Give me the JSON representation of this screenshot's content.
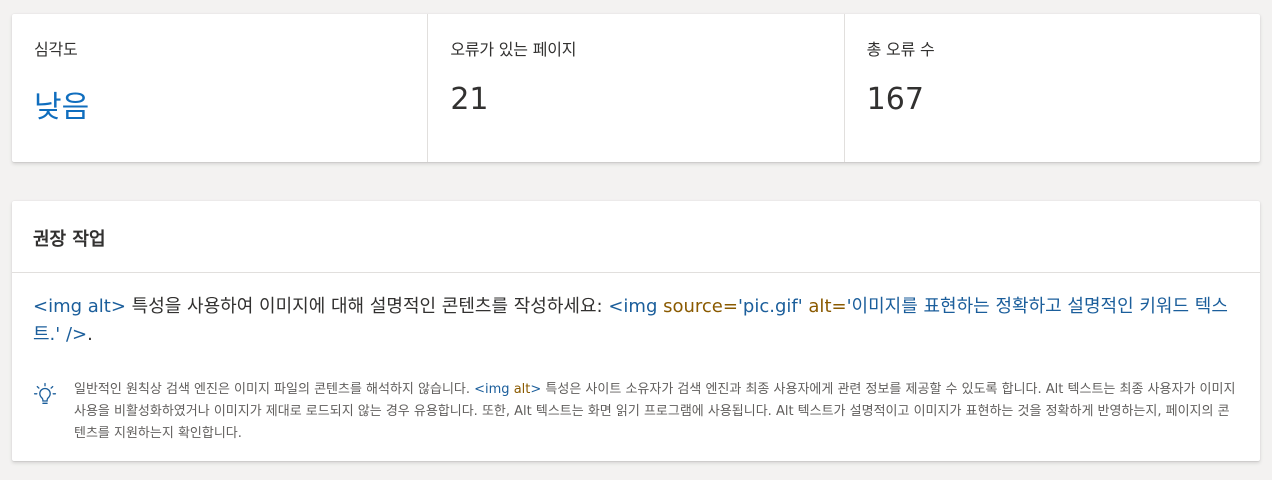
{
  "stats": {
    "severity_label": "심각도",
    "severity_value": "낮음",
    "pages_label": "오류가 있는 페이지",
    "pages_value": "21",
    "errors_label": "총 오류 수",
    "errors_value": "167"
  },
  "recommendation": {
    "title": "권장 작업",
    "main": {
      "code1": "<img alt>",
      "text1": " 특성을 사용하여 이미지에 대해 설명적인 콘텐츠를 작성하세요: ",
      "code2a": "<img ",
      "code2b": "source=",
      "code2c": "'pic.gif' ",
      "code2d": "alt=",
      "code2e": "'이미지를 표현하는 정확하고 설명적인 키워드 텍스트.' />",
      "text2": "."
    },
    "tip": {
      "icon": "lightbulb-icon",
      "text1": "일반적인 원칙상 검색 엔진은 이미지 파일의 콘텐츠를 해석하지 않습니다. ",
      "code1": "<img ",
      "code2": "alt",
      "code3": ">",
      "text2": " 특성은 사이트 소유자가 검색 엔진과 최종 사용자에게 관련 정보를 제공할 수 있도록 합니다. Alt 텍스트는 최종 사용자가 이미지 사용을 비활성화하였거나 이미지가 제대로 로드되지 않는 경우 유용합니다. 또한, Alt 텍스트는 화면 읽기 프로그램에 사용됩니다. Alt 텍스트가 설명적이고 이미지가 표현하는 것을 정확하게 반영하는지, 페이지의 콘텐츠를 지원하는지 확인합니다."
    }
  },
  "colors": {
    "accent": "#106ebe",
    "code_blue": "#1b5e9b",
    "code_brown": "#8a5a00",
    "background": "#f3f2f1"
  }
}
